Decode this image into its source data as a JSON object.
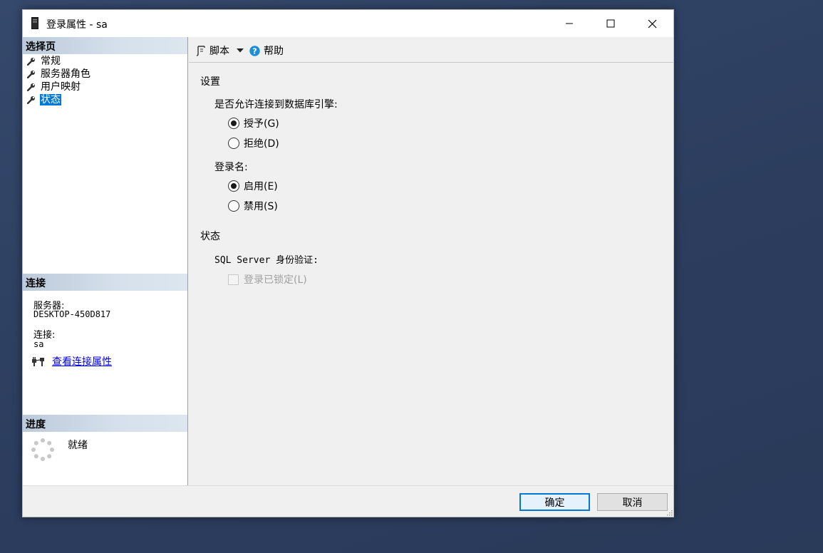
{
  "window": {
    "title": "登录属性 - sa"
  },
  "left": {
    "select_page_header": "选择页",
    "pages": [
      {
        "label": "常规"
      },
      {
        "label": "服务器角色"
      },
      {
        "label": "用户映射"
      },
      {
        "label": "状态",
        "selected": true
      }
    ],
    "connection_header": "连接",
    "server_label": "服务器:",
    "server_value": "DESKTOP-450D817",
    "connection_label": "连接:",
    "connection_value": "sa",
    "view_connection_link": "查看连接属性",
    "progress_header": "进度",
    "progress_status": "就绪"
  },
  "toolbar": {
    "script_label": "脚本",
    "help_label": "帮助"
  },
  "settings": {
    "group_title": "设置",
    "permission_question": "是否允许连接到数据库引擎:",
    "grant_label": "授予(G)",
    "deny_label": "拒绝(D)",
    "login_question": "登录名:",
    "enable_label": "启用(E)",
    "disable_label": "禁用(S)"
  },
  "status": {
    "group_title": "状态",
    "auth_label": "SQL Server 身份验证:",
    "locked_label": "登录已锁定(L)"
  },
  "footer": {
    "ok_label": "确定",
    "cancel_label": "取消"
  },
  "colors": {
    "selection": "#0078d7",
    "link": "#0000e0",
    "help_icon": "#1e8fd6",
    "desktop": "#2f4163"
  }
}
